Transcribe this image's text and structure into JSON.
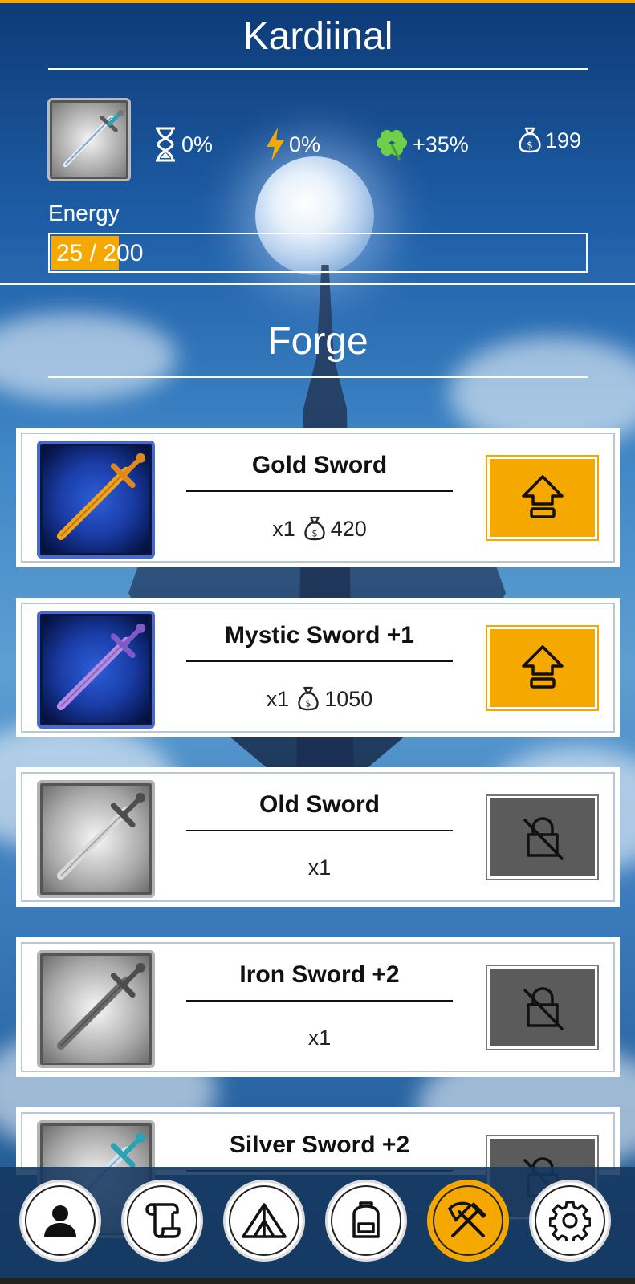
{
  "header": {
    "player_name": "Kardiinal",
    "stats": {
      "time_bonus": "0%",
      "energy_bonus": "0%",
      "luck_bonus": "+35%",
      "money": "199"
    },
    "energy_label": "Energy",
    "energy_text": "25 / 200",
    "energy_current": 25,
    "energy_max": 200
  },
  "section_title": "Forge",
  "items": [
    {
      "name": "Gold Sword",
      "quantity": "x1",
      "price": "420",
      "state": "upgrade",
      "icon": "gold-sword-icon",
      "blade_color": "#f3a21c"
    },
    {
      "name": "Mystic Sword +1",
      "quantity": "x1",
      "price": "1050",
      "state": "upgrade",
      "icon": "mystic-sword-icon",
      "blade_color": "#b58bea"
    },
    {
      "name": "Old Sword",
      "quantity": "x1",
      "price": "",
      "state": "locked",
      "icon": "old-sword-icon",
      "blade_color": "#d9d9d9"
    },
    {
      "name": "Iron Sword +2",
      "quantity": "x1",
      "price": "",
      "state": "locked",
      "icon": "iron-sword-icon",
      "blade_color": "#6c6c6c"
    },
    {
      "name": "Silver Sword +2",
      "quantity": "",
      "price": "",
      "state": "locked",
      "icon": "silver-sword-icon",
      "blade_color": "#cfe3f5"
    }
  ],
  "nav": [
    {
      "icon": "person-icon",
      "active": false
    },
    {
      "icon": "scroll-icon",
      "active": false
    },
    {
      "icon": "tent-icon",
      "active": false
    },
    {
      "icon": "backpack-icon",
      "active": false
    },
    {
      "icon": "hammer-pickaxe-icon",
      "active": true
    },
    {
      "icon": "gear-icon",
      "active": false
    }
  ],
  "colors": {
    "accent": "#f5a800",
    "locked": "#5b5b5b",
    "active_border": "#4a68d0"
  }
}
